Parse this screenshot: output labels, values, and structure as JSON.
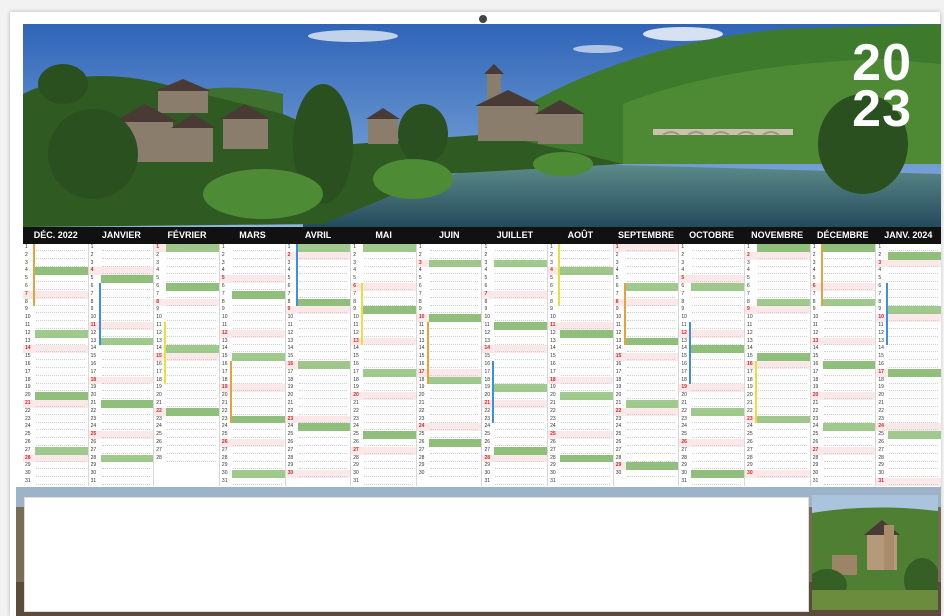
{
  "calendar": {
    "year_line_1": "20",
    "year_line_2": "23",
    "months": [
      "DÉC. 2022",
      "JANVIER",
      "FÉVRIER",
      "MARS",
      "AVRIL",
      "MAI",
      "JUIN",
      "JUILLET",
      "AOÛT",
      "SEPTEMBRE",
      "OCTOBRE",
      "NOVEMBRE",
      "DÉCEMBRE",
      "JANV. 2024"
    ]
  },
  "colors": {
    "sky": "#3f78c8",
    "hill": "#3f7a2e",
    "river": "#3a6a7c",
    "header_bar": "#111111",
    "holiday_green": "#8fbf7a",
    "week_red": "#d22222"
  }
}
